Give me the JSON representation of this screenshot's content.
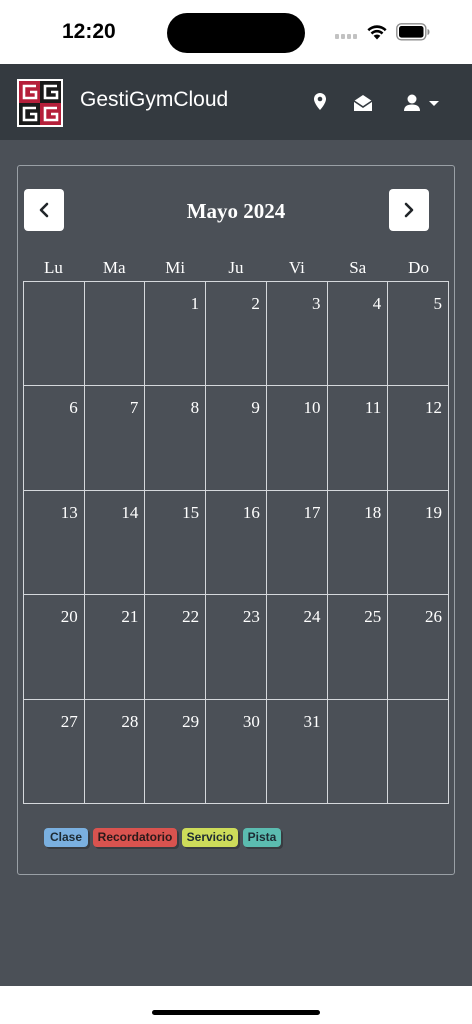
{
  "status": {
    "time": "12:20"
  },
  "header": {
    "title": "GestiGymCloud",
    "icons": [
      "location-pin-icon",
      "envelope-open-icon",
      "user-icon",
      "caret-down-icon"
    ]
  },
  "calendar": {
    "title": "Mayo 2024",
    "prev_icon": "chevron-left-icon",
    "next_icon": "chevron-right-icon",
    "weekdays": [
      "Lu",
      "Ma",
      "Mi",
      "Ju",
      "Vi",
      "Sa",
      "Do"
    ],
    "weeks": [
      [
        "",
        "",
        "1",
        "2",
        "3",
        "4",
        "5"
      ],
      [
        "6",
        "7",
        "8",
        "9",
        "10",
        "11",
        "12"
      ],
      [
        "13",
        "14",
        "15",
        "16",
        "17",
        "18",
        "19"
      ],
      [
        "20",
        "21",
        "22",
        "23",
        "24",
        "25",
        "26"
      ],
      [
        "27",
        "28",
        "29",
        "30",
        "31",
        "",
        ""
      ]
    ]
  },
  "legend": [
    {
      "label": "Clase",
      "color": "#7ab0e0"
    },
    {
      "label": "Recordatorio",
      "color": "#d9534f"
    },
    {
      "label": "Servicio",
      "color": "#cddc5a"
    },
    {
      "label": "Pista",
      "color": "#5bbcb0"
    }
  ],
  "colors": {
    "header_bg": "#343a40",
    "main_bg": "#4b5057",
    "grid_line": "#d5d8dc"
  }
}
